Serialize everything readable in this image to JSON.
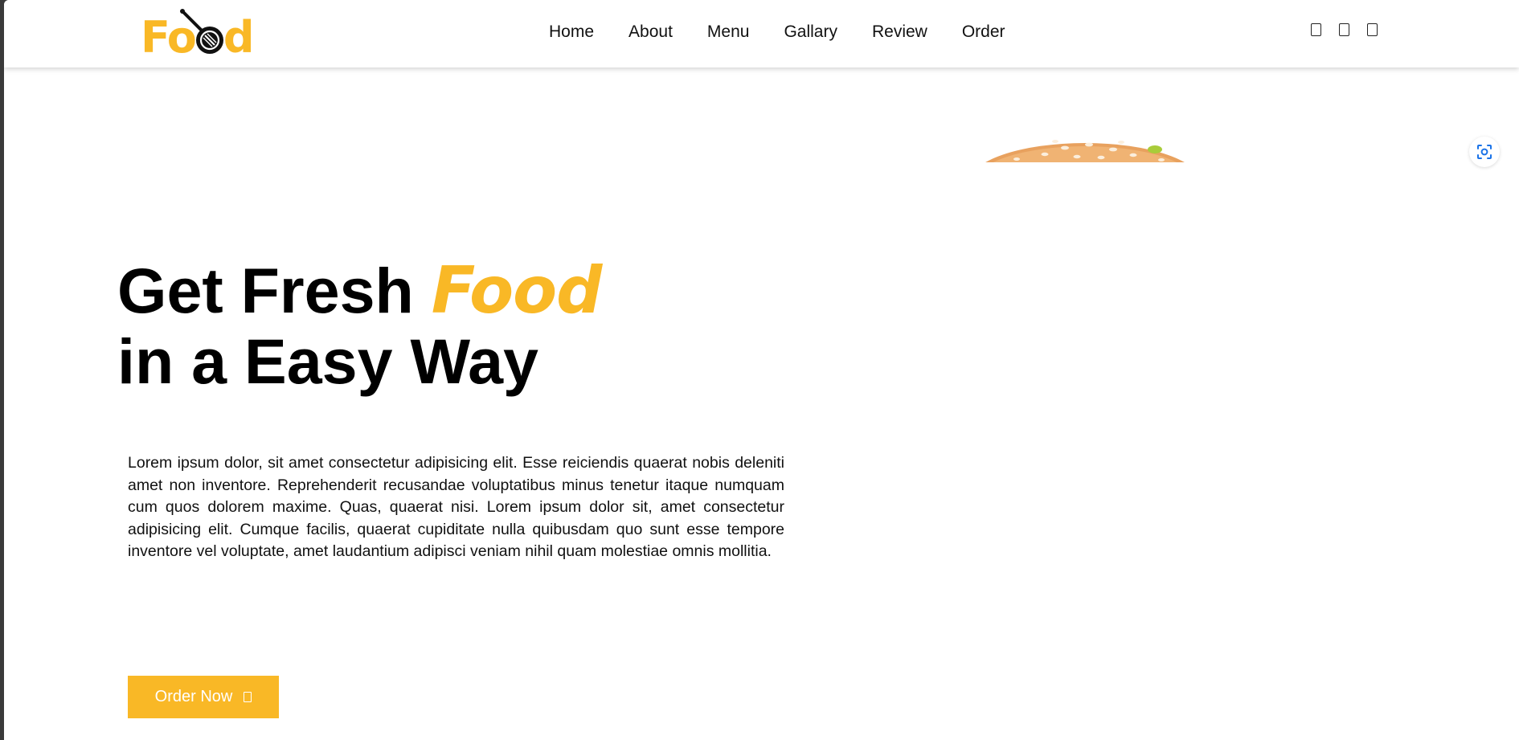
{
  "brand": {
    "logo_text": "Food",
    "accent_color": "#f9b826"
  },
  "nav": {
    "links": [
      "Home",
      "About",
      "Menu",
      "Gallary",
      "Review",
      "Order"
    ],
    "icons": [
      "search-icon",
      "cart-icon",
      "user-icon"
    ]
  },
  "hero": {
    "title_line1_prefix": "Get Fresh ",
    "title_accent": "Food",
    "title_line2": "in a Easy Way",
    "description": "Lorem ipsum dolor, sit amet consectetur adipisicing elit. Esse reiciendis quaerat nobis deleniti amet non inventore. Reprehenderit recusandae voluptatibus minus tenetur itaque numquam cum quos dolorem maxime. Quas, quaerat nisi. Lorem ipsum dolor sit, amet consectetur adipisicing elit. Cumque facilis, quaerat cupiditate nulla quibusdam quo sunt esse tempore inventore vel voluptate, amet laudantium adipisci veniam nihil quam molestiae omnis mollitia.",
    "cta_label": "Order Now",
    "image": "burger-image"
  },
  "overlay": {
    "lens_button": "lens-icon"
  }
}
